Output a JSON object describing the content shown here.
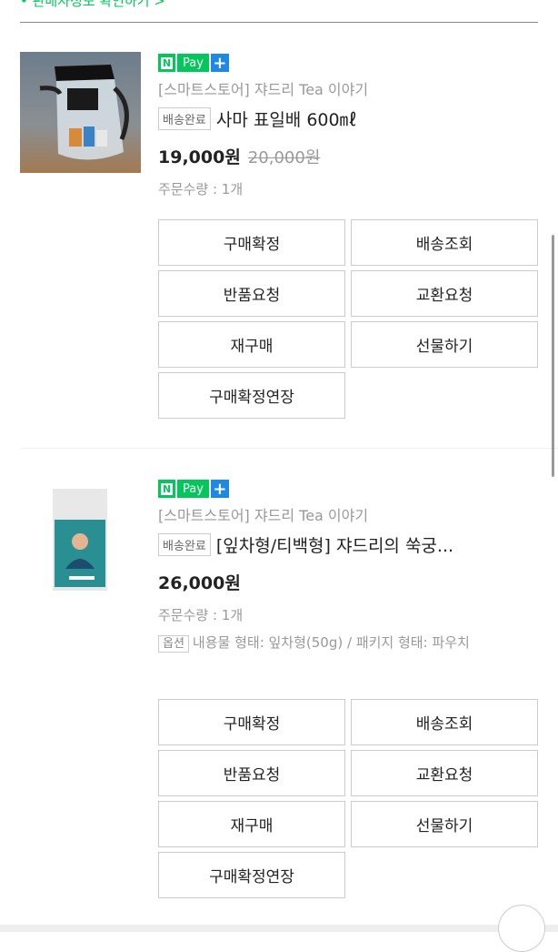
{
  "top_link": "• 판매자정보 확인하기 >",
  "npay": {
    "n": "N",
    "pay": "Pay",
    "plus": "+"
  },
  "orders": [
    {
      "store": "[스마트스토어] 쟈드리 Tea 이야기",
      "status_badge": "배송완료",
      "title": "사마 표일배 600㎖",
      "price": "19,000원",
      "original_price": "20,000원",
      "quantity": "주문수량 : 1개",
      "buttons": [
        "구매확정",
        "배송조회",
        "반품요청",
        "교환요청",
        "재구매",
        "선물하기",
        "구매확정연장"
      ]
    },
    {
      "store": "[스마트스토어] 쟈드리 Tea 이야기",
      "status_badge": "배송완료",
      "title": "[잎차형/티백형] 쟈드리의 쑥궁...",
      "price": "26,000원",
      "quantity": "주문수량 : 1개",
      "option_badge": "옵션",
      "option_text": "내용물 형태: 잎차형(50g) / 패키지 형태: 파우치",
      "buttons": [
        "구매확정",
        "배송조회",
        "반품요청",
        "교환요청",
        "재구매",
        "선물하기",
        "구매확정연장"
      ]
    }
  ],
  "colors": {
    "accent": "#03c75a",
    "npay_plus": "#1e88e5"
  }
}
